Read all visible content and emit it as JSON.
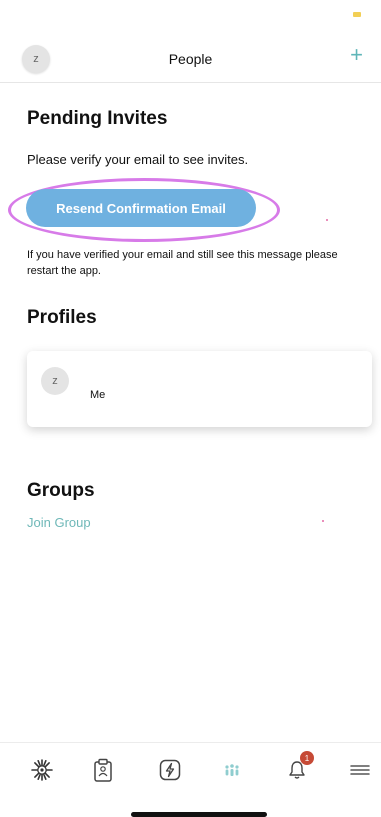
{
  "header": {
    "avatar_initial": "z",
    "title": "People",
    "add_icon": "plus-icon"
  },
  "pending": {
    "title": "Pending Invites",
    "verify_text": "Please verify your email to see invites.",
    "resend_label": "Resend Confirmation Email",
    "restart_text": "If you have verified your email and still see this message please restart the app."
  },
  "profiles": {
    "title": "Profiles",
    "items": [
      {
        "avatar_initial": "z",
        "name": "Me"
      }
    ]
  },
  "groups": {
    "title": "Groups",
    "join_label": "Join Group"
  },
  "bottom_nav": {
    "items": [
      {
        "icon": "sunflower-icon"
      },
      {
        "icon": "clipboard-icon"
      },
      {
        "icon": "lightning-icon"
      },
      {
        "icon": "people-icon"
      },
      {
        "icon": "bell-icon",
        "badge": "1"
      },
      {
        "icon": "menu-icon"
      }
    ]
  },
  "colors": {
    "accent_teal": "#5fb6b8",
    "button_blue": "#6fb1e0",
    "highlight_purple": "#d77be8",
    "badge_red": "#c64a36"
  }
}
